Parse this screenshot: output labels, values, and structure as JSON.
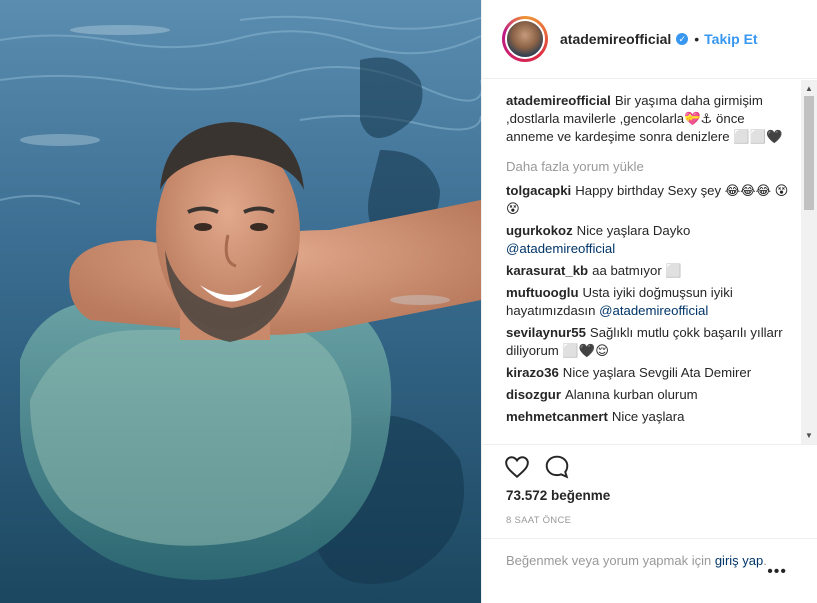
{
  "header": {
    "username": "atademireofficial",
    "verified_symbol": "✓",
    "separator": "•",
    "follow_label": "Takip Et"
  },
  "caption": {
    "username": "atademireofficial",
    "text": "Bir yaşıma daha girmişim ,dostlarla mavilerle ,gencolarla💝⚓ önce anneme ve kardeşime sonra denizlere ⬜⬜🖤"
  },
  "load_more_label": "Daha fazla yorum yükle",
  "comments": [
    {
      "username": "tolgacapki",
      "text": "Happy birthday Sexy şey 😂😂😂 😵😵"
    },
    {
      "username": "ugurkokoz",
      "text": "Nice yaşlara Dayko",
      "mention": "@atademireofficial"
    },
    {
      "username": "karasurat_kb",
      "text": "aa batmıyor ⬜"
    },
    {
      "username": "muftuooglu",
      "text": "Usta iyiki doğmuşsun iyiki hayatımızdasın",
      "mention": "@atademireofficial"
    },
    {
      "username": "sevilaynur55",
      "text": "Sağlıklı mutlu çokk başarılı yıllarr diliyorum ⬜🖤😌"
    },
    {
      "username": "kirazo36",
      "text": "Nice yaşlara Sevgili Ata Demirer"
    },
    {
      "username": "disozgur",
      "text": "Alanına kurban olurum"
    },
    {
      "username": "mehmetcanmert",
      "text": "Nice yaşlara"
    }
  ],
  "icons": {
    "like": "heart-outline-icon",
    "comment": "speech-bubble-icon",
    "more": "ellipsis-icon"
  },
  "likes_label": "73.572 beğenme",
  "time_label": "8 SAAT ÖNCE",
  "login_prompt": {
    "text": "Beğenmek veya yorum yapmak için",
    "link": "giriş yap",
    "suffix": "."
  },
  "more_label": "•••",
  "colors": {
    "link": "#003569",
    "follow": "#3897f0",
    "muted": "#999999"
  }
}
